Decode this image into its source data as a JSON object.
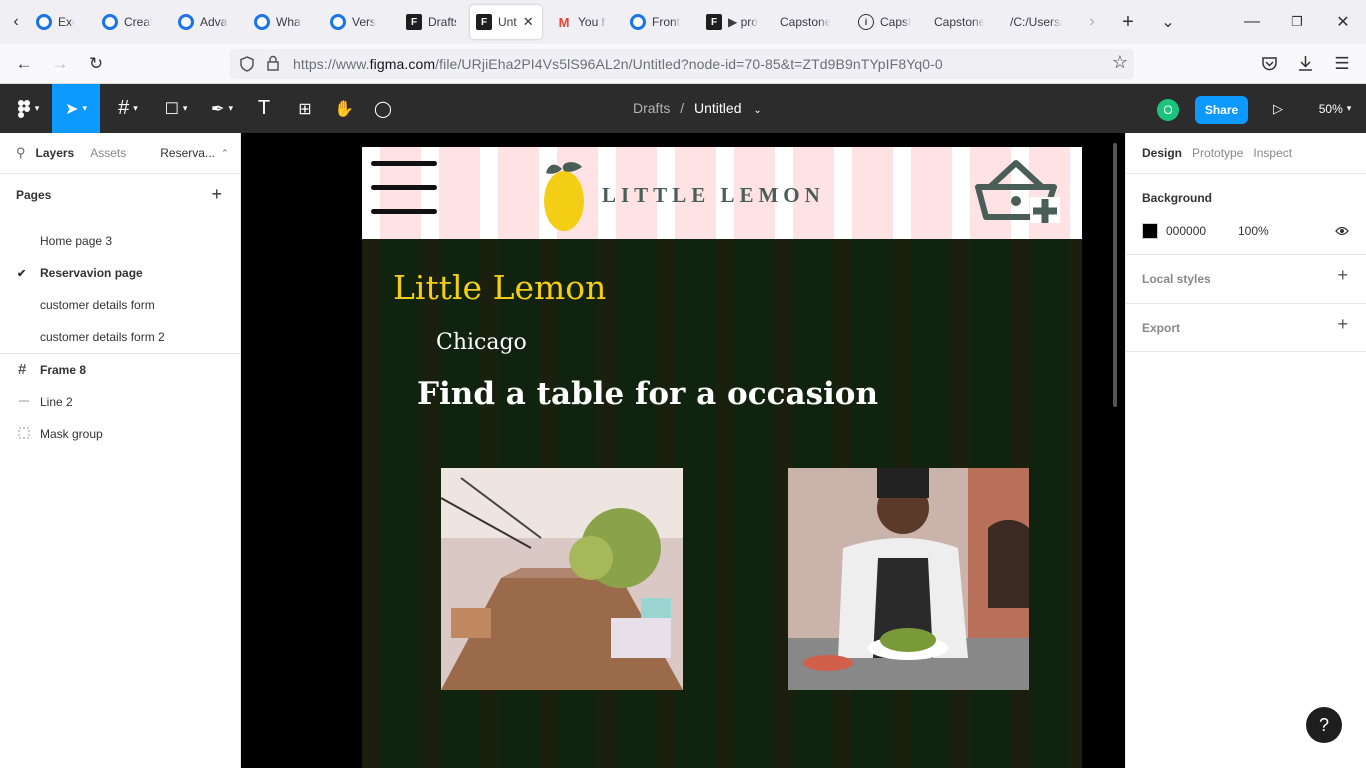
{
  "browser": {
    "tabs": [
      {
        "label": "Exerci",
        "icon": "coursera-icon"
      },
      {
        "label": "Create",
        "icon": "coursera-icon"
      },
      {
        "label": "Advan",
        "icon": "coursera-icon"
      },
      {
        "label": "What",
        "icon": "coursera-icon"
      },
      {
        "label": "Versio",
        "icon": "coursera-icon"
      },
      {
        "label": "Drafts",
        "icon": "figma-icon"
      },
      {
        "label": "Unt",
        "icon": "figma-icon"
      },
      {
        "label": "You h",
        "icon": "gmail-icon"
      },
      {
        "label": "Front",
        "icon": "coursera-icon"
      },
      {
        "label": "▶ pro",
        "icon": "figma-icon"
      },
      {
        "label": "Capstone",
        "icon": ""
      },
      {
        "label": "Capst",
        "icon": "info-icon"
      },
      {
        "label": "Capstone",
        "icon": ""
      },
      {
        "label": "/C:/Users/",
        "icon": ""
      }
    ],
    "url_prefix": "https://www.",
    "url_domain": "figma.com",
    "url_rest": "/file/URjiEha2PI4Vs5lS96AL2n/Untitled?node-id=70-85&t=ZTd9B9nTYpIF8Yq0-0"
  },
  "figma": {
    "toolbar": {
      "breadcrumb_folder": "Drafts",
      "breadcrumb_sep": "/",
      "file_name": "Untitled",
      "avatar_initial": "O",
      "share_label": "Share",
      "zoom": "50%"
    },
    "left_panel": {
      "tabs": [
        "Layers",
        "Assets"
      ],
      "page_selector": "Reserva...",
      "pages_title": "Pages",
      "pages": [
        {
          "label": "Home page 3",
          "current": false
        },
        {
          "label": "Reservavion page",
          "current": true
        },
        {
          "label": "customer details form",
          "current": false
        },
        {
          "label": "customer details form 2",
          "current": false
        }
      ],
      "layers": [
        {
          "label": "Frame 8",
          "icon": "frame-icon"
        },
        {
          "label": "Line 2",
          "icon": "line-icon"
        },
        {
          "label": "Mask group",
          "icon": "mask-group-icon"
        }
      ]
    },
    "right_panel": {
      "tabs": [
        "Design",
        "Prototype",
        "Inspect"
      ],
      "background_title": "Background",
      "bg_hex": "000000",
      "bg_opacity": "100%",
      "local_styles": "Local styles",
      "export": "Export"
    },
    "canvas": {
      "brand_name": "LITTLE LEMON",
      "hero_title": "Little Lemon",
      "hero_city": "Chicago",
      "hero_subtitle": "Find a table for a occasion"
    },
    "help_label": "?"
  },
  "colors": {
    "accent": "#0d99ff",
    "lemon": "#f4ce14",
    "brand_green": "#495e57"
  }
}
